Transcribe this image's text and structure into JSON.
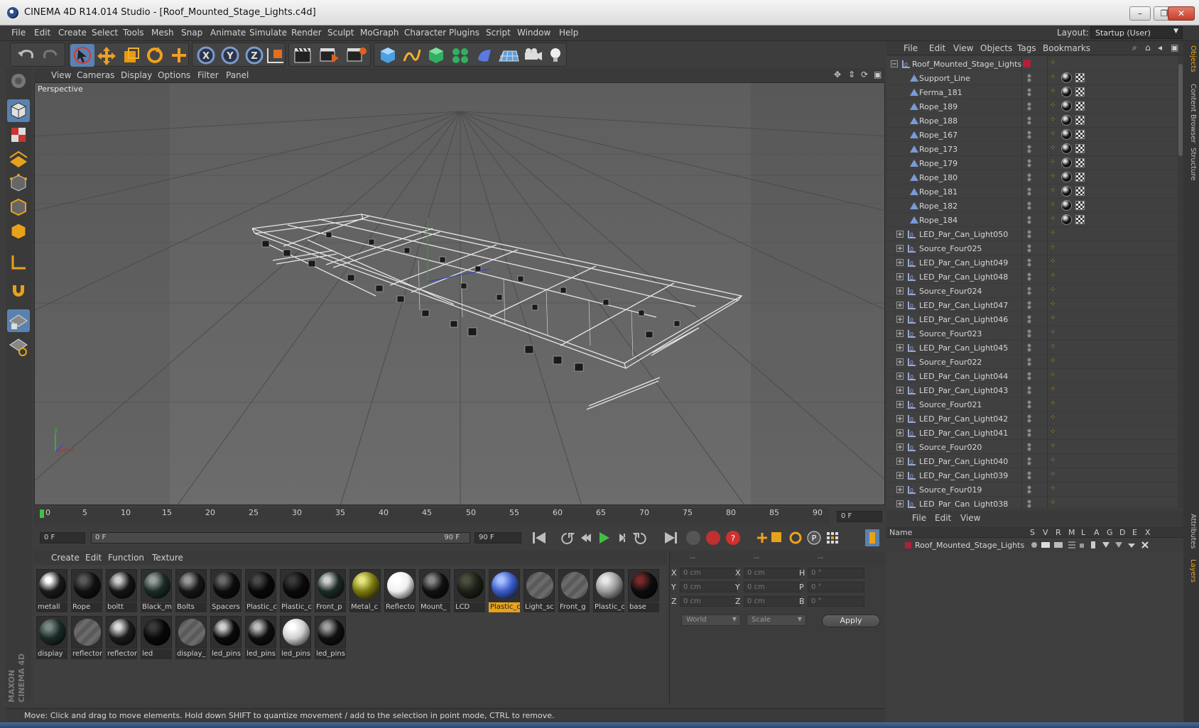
{
  "window": {
    "title": "CINEMA 4D R14.014 Studio - [Roof_Mounted_Stage_Lights.c4d]",
    "controls": [
      "–",
      "❐",
      "✕"
    ]
  },
  "menu": [
    "File",
    "Edit",
    "Create",
    "Select",
    "Tools",
    "Mesh",
    "Snap",
    "Animate",
    "Simulate",
    "Render",
    "Sculpt",
    "MoGraph",
    "Character",
    "Plugins",
    "Script",
    "Window",
    "Help"
  ],
  "layout": {
    "label": "Layout:",
    "value": "Startup (User)"
  },
  "viewport": {
    "menu": [
      "View",
      "Cameras",
      "Display",
      "Options",
      "Filter",
      "Panel"
    ],
    "label": "Perspective"
  },
  "timeline": {
    "ticks": [
      "0",
      "5",
      "10",
      "15",
      "20",
      "25",
      "30",
      "35",
      "40",
      "45",
      "50",
      "55",
      "60",
      "65",
      "70",
      "75",
      "80",
      "85",
      "90"
    ],
    "current_frame": "0 F",
    "start_field": "0 F",
    "range_start": "0 F",
    "range_end": "90 F",
    "end_field": "90 F"
  },
  "materials": {
    "menu": [
      "Create",
      "Edit",
      "Function",
      "Texture"
    ],
    "items": [
      {
        "name": "metall",
        "color": "#1a1a1a",
        "shine": "#ffffff",
        "empty": false,
        "selected": false
      },
      {
        "name": "Rope",
        "color": "#101010",
        "shine": "#5a5a5a",
        "empty": false,
        "selected": false
      },
      {
        "name": "boltt",
        "color": "#141414",
        "shine": "#cfcfcf",
        "empty": false,
        "selected": false
      },
      {
        "name": "Black_m",
        "color": "#1a2a22",
        "shine": "#9aa0a0",
        "empty": false,
        "selected": false
      },
      {
        "name": "Bolts",
        "color": "#161616",
        "shine": "#9a9a9a",
        "empty": false,
        "selected": false
      },
      {
        "name": "Spacers",
        "color": "#0c0c0c",
        "shine": "#6a6a6a",
        "empty": false,
        "selected": false
      },
      {
        "name": "Plastic_c",
        "color": "#080808",
        "shine": "#4a4a4a",
        "empty": false,
        "selected": false
      },
      {
        "name": "Plastic_c",
        "color": "#0a0a0a",
        "shine": "#3a3a3a",
        "empty": false,
        "selected": false
      },
      {
        "name": "Front_p",
        "color": "#1a2a26",
        "shine": "#d0d0d0",
        "empty": false,
        "selected": false
      },
      {
        "name": "Metal_c",
        "color": "#7a7a10",
        "shine": "#e6e680",
        "empty": false,
        "selected": false
      },
      {
        "name": "Reflecto",
        "color": "#f0f0f0",
        "shine": "#ffffff",
        "empty": false,
        "selected": false
      },
      {
        "name": "Mount_",
        "color": "#101010",
        "shine": "#8a8a8a",
        "empty": false,
        "selected": false
      },
      {
        "name": "LCD",
        "color": "#1c2018",
        "shine": "#4a5040",
        "empty": false,
        "selected": false
      },
      {
        "name": "Plastic_c",
        "color": "#3a5cc8",
        "shine": "#a8c0ff",
        "empty": false,
        "selected": true
      },
      {
        "name": "Light_sc",
        "color": "#5a5a5a",
        "shine": "#6a6a6a",
        "empty": true,
        "selected": false
      },
      {
        "name": "Front_g",
        "color": "#5a5a5a",
        "shine": "#6a6a6a",
        "empty": true,
        "selected": false
      },
      {
        "name": "Plastic_c",
        "color": "#9a9a9a",
        "shine": "#e8e8e8",
        "empty": false,
        "selected": false
      },
      {
        "name": "base",
        "color": "#0c0c0c",
        "shine": "#7a2a2a",
        "empty": false,
        "selected": false
      },
      {
        "name": "display",
        "color": "#1a2a26",
        "shine": "#7a8a88",
        "empty": false,
        "selected": false
      },
      {
        "name": "reflector",
        "color": "#5a5a5a",
        "shine": "#6a6a6a",
        "empty": true,
        "selected": false
      },
      {
        "name": "reflector",
        "color": "#1a1a1a",
        "shine": "#dcdcdc",
        "empty": false,
        "selected": false
      },
      {
        "name": "led",
        "color": "#080808",
        "shine": "#3a3a3a",
        "empty": false,
        "selected": false
      },
      {
        "name": "display_",
        "color": "#5a5a5a",
        "shine": "#6a6a6a",
        "empty": true,
        "selected": false
      },
      {
        "name": "led_pins",
        "color": "#0a0a0a",
        "shine": "#cfcfcf",
        "empty": false,
        "selected": false
      },
      {
        "name": "led_pins",
        "color": "#0e0e0e",
        "shine": "#bdbdbd",
        "empty": false,
        "selected": false
      },
      {
        "name": "led_pins",
        "color": "#cfcfcf",
        "shine": "#ffffff",
        "empty": false,
        "selected": false
      },
      {
        "name": "led_pins",
        "color": "#101010",
        "shine": "#a0a0a0",
        "empty": false,
        "selected": false
      }
    ]
  },
  "coordinates": {
    "col_headers": [
      "--",
      "--",
      "--"
    ],
    "rows": [
      {
        "l1": "X",
        "v1": "0 cm",
        "l2": "X",
        "v2": "0 cm",
        "l3": "H",
        "v3": "0 °"
      },
      {
        "l1": "Y",
        "v1": "0 cm",
        "l2": "Y",
        "v2": "0 cm",
        "l3": "P",
        "v3": "0 °"
      },
      {
        "l1": "Z",
        "v1": "0 cm",
        "l2": "Z",
        "v2": "0 cm",
        "l3": "B",
        "v3": "0 °"
      }
    ],
    "mode": "World",
    "scale": "Scale",
    "apply": "Apply"
  },
  "status": "Move: Click and drag to move elements. Hold down SHIFT to quantize movement / add to the selection in point mode, CTRL to remove.",
  "maxon": "MAXON CINEMA 4D",
  "objects": {
    "menu": [
      "File",
      "Edit",
      "View",
      "Objects",
      "Tags",
      "Bookmarks"
    ],
    "root": "Roof_Mounted_Stage_Lights",
    "items": [
      {
        "name": "Support_Line",
        "kind": "spline",
        "tags": true
      },
      {
        "name": "Ferma_181",
        "kind": "spline",
        "tags": true
      },
      {
        "name": "Rope_189",
        "kind": "spline",
        "tags": true
      },
      {
        "name": "Rope_188",
        "kind": "spline",
        "tags": true
      },
      {
        "name": "Rope_167",
        "kind": "spline",
        "tags": true
      },
      {
        "name": "Rope_173",
        "kind": "spline",
        "tags": true
      },
      {
        "name": "Rope_179",
        "kind": "spline",
        "tags": true
      },
      {
        "name": "Rope_180",
        "kind": "spline",
        "tags": true
      },
      {
        "name": "Rope_181",
        "kind": "spline",
        "tags": true
      },
      {
        "name": "Rope_182",
        "kind": "spline",
        "tags": true
      },
      {
        "name": "Rope_184",
        "kind": "spline",
        "tags": true
      },
      {
        "name": "LED_Par_Can_Light050",
        "kind": "null",
        "tags": false
      },
      {
        "name": "Source_Four025",
        "kind": "null",
        "tags": false
      },
      {
        "name": "LED_Par_Can_Light049",
        "kind": "null",
        "tags": false
      },
      {
        "name": "LED_Par_Can_Light048",
        "kind": "null",
        "tags": false
      },
      {
        "name": "Source_Four024",
        "kind": "null",
        "tags": false
      },
      {
        "name": "LED_Par_Can_Light047",
        "kind": "null",
        "tags": false
      },
      {
        "name": "LED_Par_Can_Light046",
        "kind": "null",
        "tags": false
      },
      {
        "name": "Source_Four023",
        "kind": "null",
        "tags": false
      },
      {
        "name": "LED_Par_Can_Light045",
        "kind": "null",
        "tags": false
      },
      {
        "name": "Source_Four022",
        "kind": "null",
        "tags": false
      },
      {
        "name": "LED_Par_Can_Light044",
        "kind": "null",
        "tags": false
      },
      {
        "name": "LED_Par_Can_Light043",
        "kind": "null",
        "tags": false
      },
      {
        "name": "Source_Four021",
        "kind": "null",
        "tags": false
      },
      {
        "name": "LED_Par_Can_Light042",
        "kind": "null",
        "tags": false
      },
      {
        "name": "LED_Par_Can_Light041",
        "kind": "null",
        "tags": false
      },
      {
        "name": "Source_Four020",
        "kind": "null",
        "tags": false
      },
      {
        "name": "LED_Par_Can_Light040",
        "kind": "null",
        "tags": false
      },
      {
        "name": "LED_Par_Can_Light039",
        "kind": "null",
        "tags": false
      },
      {
        "name": "Source_Four019",
        "kind": "null",
        "tags": false
      },
      {
        "name": "LED_Par_Can_Light038",
        "kind": "null",
        "tags": false
      }
    ]
  },
  "layers": {
    "menu": [
      "File",
      "Edit",
      "View"
    ],
    "columns": [
      "Name",
      "S",
      "V",
      "R",
      "M",
      "L",
      "A",
      "G",
      "D",
      "E",
      "X"
    ],
    "row": "Roof_Mounted_Stage_Lights"
  },
  "side_tabs": [
    "Objects",
    "Content Browser",
    "Structure",
    "Attributes",
    "Layers"
  ],
  "colors": {
    "accent": "#e8a21a",
    "selection_blue": "#5a82b0",
    "layer_red": "#b0203a"
  }
}
